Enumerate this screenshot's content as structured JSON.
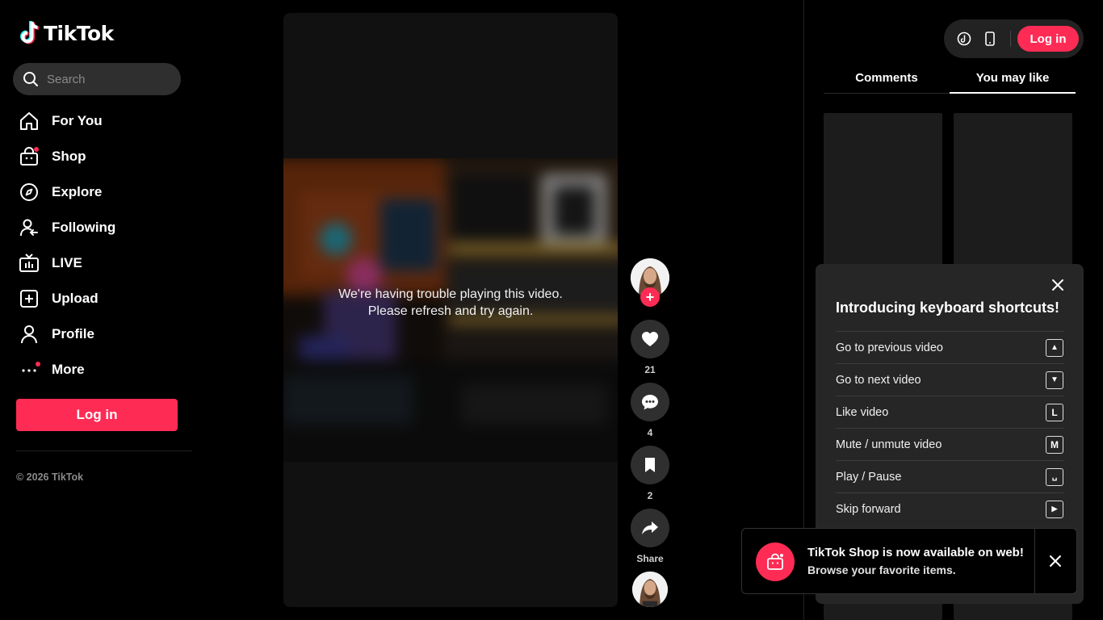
{
  "sidebar": {
    "logo_text": "TikTok",
    "search_placeholder": "Search",
    "nav": [
      {
        "label": "For You",
        "icon": "home-icon"
      },
      {
        "label": "Shop",
        "icon": "shopping-bag-icon"
      },
      {
        "label": "Explore",
        "icon": "compass-icon"
      },
      {
        "label": "Following",
        "icon": "following-icon"
      },
      {
        "label": "LIVE",
        "icon": "live-tv-icon"
      },
      {
        "label": "Upload",
        "icon": "plus-square-icon"
      },
      {
        "label": "Profile",
        "icon": "person-icon"
      },
      {
        "label": "More",
        "icon": "more-dots-icon"
      }
    ],
    "login_label": "Log in",
    "copyright": "© 2026 TikTok"
  },
  "video": {
    "error_line1": "We're having trouble playing this video.",
    "error_line2": "Please refresh and try again."
  },
  "actions": {
    "likes": "21",
    "comments": "4",
    "saves": "2",
    "share_label": "Share"
  },
  "header": {
    "login_label": "Log in"
  },
  "tabs": [
    {
      "label": "Comments",
      "active": false
    },
    {
      "label": "You may like",
      "active": true
    }
  ],
  "shortcuts": {
    "title": "Introducing keyboard shortcuts!",
    "items": [
      {
        "label": "Go to previous video",
        "key": "▲"
      },
      {
        "label": "Go to next video",
        "key": "▼"
      },
      {
        "label": "Like video",
        "key": "L"
      },
      {
        "label": "Mute / unmute video",
        "key": "M"
      },
      {
        "label": "Play / Pause",
        "key": "␣"
      },
      {
        "label": "Skip forward",
        "key": "▶"
      }
    ]
  },
  "toast": {
    "title": "TikTok Shop is now available on web!",
    "subtitle": "Browse your favorite items."
  },
  "colors": {
    "accent": "#fe2c55",
    "background": "#000000",
    "surface": "#262626"
  }
}
